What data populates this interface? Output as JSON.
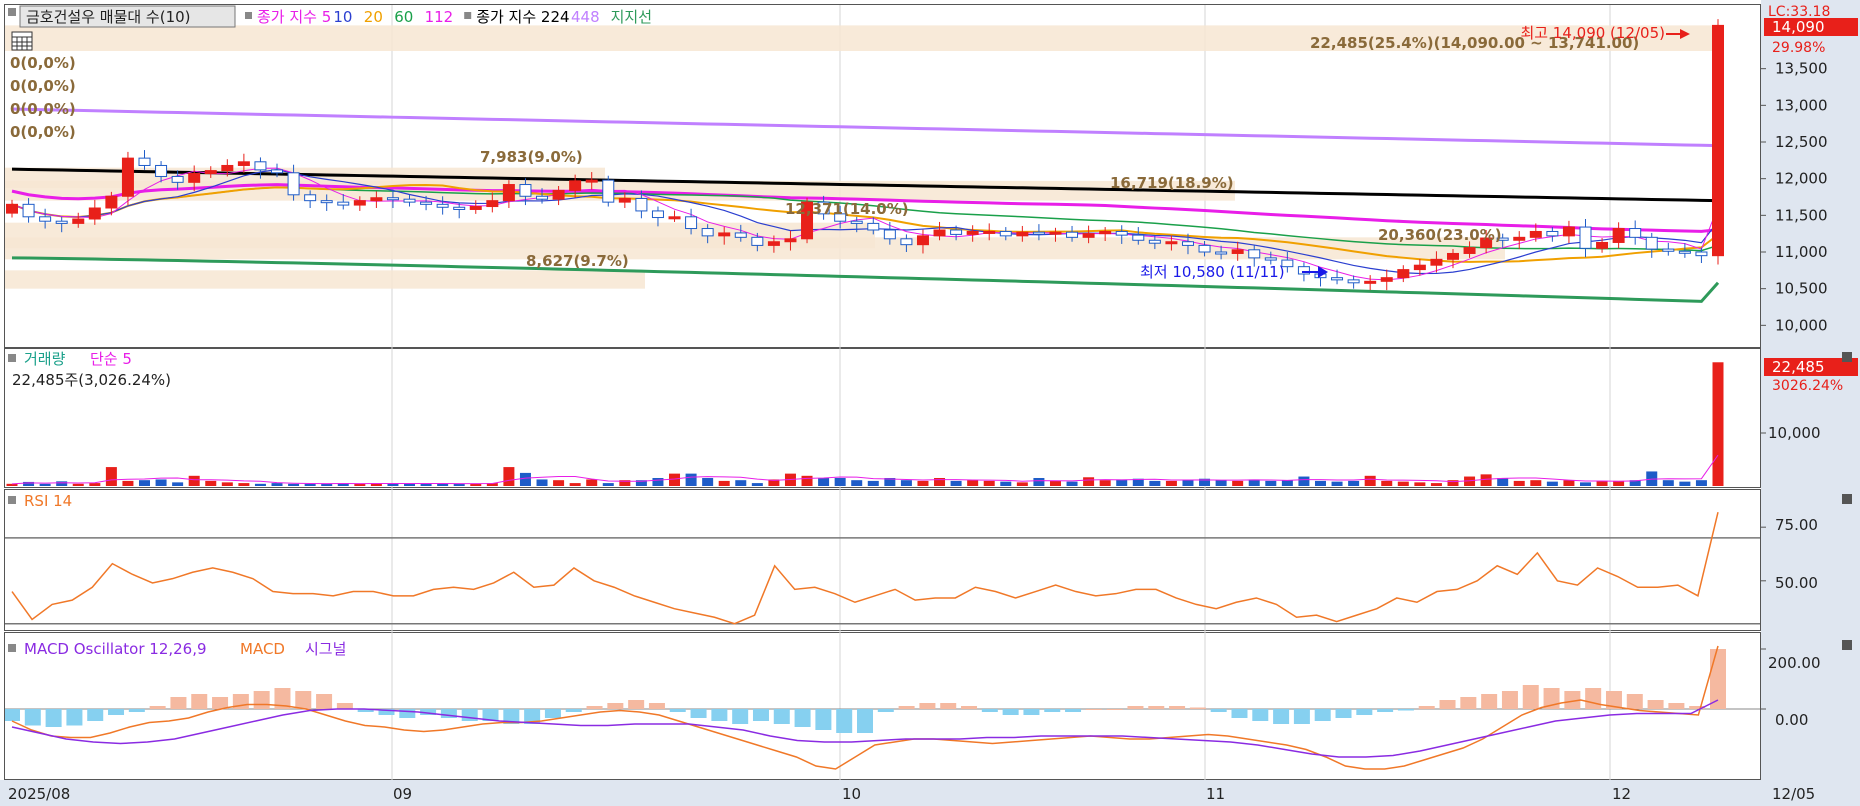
{
  "window": {
    "stock_name_button": "금호건설우 매물대 수(10)",
    "current_date_label": "12/05"
  },
  "main_panel": {
    "legend": [
      {
        "label": "종가 지수 5",
        "color": "#e81ee8"
      },
      {
        "label": "10",
        "color": "#2b3fd0"
      },
      {
        "label": "20",
        "color": "#f0a000"
      },
      {
        "label": "60",
        "color": "#1aa04a"
      },
      {
        "label": "112",
        "color": "#e81ee8"
      },
      {
        "label": "종가 지수 224",
        "color": "#000000"
      },
      {
        "label": "448",
        "color": "#c080ff"
      },
      {
        "label": "지지선",
        "color": "#2e9a5a"
      }
    ],
    "zero_labels": [
      "0(0,0%)",
      "0(0,0%)",
      "0(0,0%)",
      "0(0,0%)"
    ],
    "top_right_label": "LC:33.18",
    "price_badge": "14,090",
    "change_badge": "29.98%",
    "axis_ticks": [
      "13,500",
      "13,000",
      "12,500",
      "12,000",
      "11,500",
      "11,000",
      "10,500",
      "10,000"
    ],
    "annotations": {
      "high": "최고 14,090 (12/05)",
      "low": "최저 10,580 (11/11)",
      "top_band": "22,485(25.4%)(14,090.00 ~ 13,741.00)",
      "band_7983": "7,983(9.0%)",
      "band_16719": "16,719(18.9%)",
      "band_12371": "12,371(14.0%)",
      "band_20360": "20,360(23.0%)",
      "band_8627": "8,627(9.7%)"
    }
  },
  "volume_panel": {
    "title": "거래량",
    "ma_label": "단순 5",
    "value_text": "22,485주(3,026.24%)",
    "badge_value": "22,485",
    "badge_pct": "3026.24%",
    "axis_tick": "10,000"
  },
  "rsi_panel": {
    "title": "RSI 14",
    "axis_ticks": [
      "75.00",
      "50.00"
    ]
  },
  "macd_panel": {
    "osc_label": "MACD Oscillator 12,26,9",
    "macd_label": "MACD",
    "signal_label": "시그널",
    "axis_ticks": [
      "200.00",
      "0.00"
    ]
  },
  "date_axis": {
    "labels": [
      "2025/08",
      "09",
      "10",
      "11",
      "12"
    ]
  },
  "colors": {
    "up": "#e8201a",
    "down": "#1e5cc8",
    "axis_bg": "#dfe6f0",
    "band": "#f7e6d2",
    "rsi": "#f07828",
    "macd": "#f07828",
    "signal": "#8a2be2",
    "osc_pos": "#f5b9a0",
    "osc_neg": "#86d0f0"
  },
  "chart_data": {
    "type": "candlestick",
    "period": "2025/08 – 12/05",
    "closes": [
      11650,
      11480,
      11420,
      11390,
      11450,
      11600,
      11760,
      12280,
      12180,
      12030,
      11950,
      12070,
      12110,
      12180,
      12230,
      12120,
      12080,
      11780,
      11700,
      11680,
      11640,
      11700,
      11740,
      11720,
      11680,
      11650,
      11610,
      11580,
      11620,
      11700,
      11920,
      11760,
      11720,
      11840,
      11970,
      11980,
      11680,
      11730,
      11560,
      11470,
      11480,
      11320,
      11220,
      11260,
      11200,
      11090,
      11140,
      11180,
      11680,
      11520,
      11420,
      11390,
      11300,
      11180,
      11100,
      11220,
      11300,
      11240,
      11280,
      11280,
      11220,
      11270,
      11260,
      11270,
      11200,
      11250,
      11280,
      11230,
      11160,
      11120,
      11140,
      11090,
      11000,
      10980,
      11030,
      10920,
      10890,
      10800,
      10700,
      10650,
      10620,
      10580,
      10600,
      10650,
      10760,
      10820,
      10900,
      10980,
      11060,
      11190,
      11160,
      11200,
      11280,
      11220,
      11340,
      11050,
      11130,
      11320,
      11200,
      11040,
      11010,
      11000,
      10950,
      14090
    ],
    "volume": [
      150,
      280,
      150,
      320,
      150,
      200,
      1300,
      350,
      400,
      450,
      250,
      700,
      350,
      250,
      200,
      150,
      200,
      150,
      150,
      150,
      200,
      150,
      200,
      150,
      150,
      200,
      150,
      150,
      150,
      200,
      1300,
      900,
      450,
      400,
      200,
      450,
      200,
      400,
      400,
      550,
      850,
      850,
      550,
      350,
      400,
      200,
      450,
      850,
      700,
      550,
      550,
      400,
      350,
      550,
      400,
      350,
      550,
      350,
      400,
      350,
      300,
      250,
      550,
      350,
      300,
      600,
      400,
      450,
      500,
      350,
      350,
      400,
      500,
      400,
      350,
      450,
      350,
      400,
      650,
      350,
      300,
      350,
      700,
      350,
      300,
      250,
      200,
      400,
      650,
      800,
      550,
      350,
      400,
      300,
      400,
      250,
      350,
      350,
      400,
      1000,
      400,
      300,
      400,
      8500
    ],
    "ohlc_note": "ohlc derived from closes",
    "rsi": [
      45,
      32,
      39,
      41,
      47,
      58,
      53,
      49,
      51,
      54,
      56,
      54,
      51,
      45,
      44,
      44,
      43,
      45,
      45,
      43,
      43,
      46,
      47,
      46,
      49,
      54,
      47,
      48,
      56,
      50,
      47,
      43,
      40,
      37,
      35,
      33,
      30,
      34,
      57,
      46,
      47,
      44,
      40,
      43,
      46,
      41,
      42,
      42,
      47,
      45,
      42,
      45,
      48,
      45,
      43,
      44,
      46,
      46,
      42,
      39,
      37,
      40,
      42,
      39,
      33,
      34,
      31,
      34,
      37,
      42,
      40,
      45,
      46,
      50,
      57,
      53,
      63,
      50,
      48,
      56,
      52,
      47,
      47,
      48,
      43,
      82
    ],
    "rsi_levels": [
      70,
      30
    ],
    "rsi_ylim": [
      28,
      90
    ],
    "macd": [
      -40,
      -70,
      -90,
      -95,
      -95,
      -80,
      -60,
      -45,
      -40,
      -30,
      -10,
      5,
      15,
      15,
      10,
      0,
      -20,
      -40,
      -55,
      -60,
      -70,
      -75,
      -70,
      -60,
      -50,
      -45,
      -45,
      -40,
      -30,
      -20,
      -10,
      -5,
      -10,
      -20,
      -40,
      -60,
      -80,
      -100,
      -120,
      -140,
      -160,
      -190,
      -200,
      -160,
      -120,
      -110,
      -100,
      -100,
      -105,
      -110,
      -115,
      -110,
      -105,
      -100,
      -95,
      -90,
      -95,
      -100,
      -100,
      -95,
      -90,
      -85,
      -90,
      -100,
      -110,
      -120,
      -135,
      -160,
      -190,
      -200,
      -200,
      -190,
      -170,
      -150,
      -130,
      -100,
      -60,
      -20,
      5,
      20,
      30,
      15,
      5,
      -5,
      -10,
      -15,
      -20,
      210
    ],
    "signal": [
      -60,
      -80,
      -100,
      -110,
      -115,
      -110,
      -100,
      -80,
      -60,
      -40,
      -20,
      -5,
      0,
      0,
      -5,
      -10,
      -20,
      -30,
      -40,
      -45,
      -50,
      -55,
      -55,
      -50,
      -50,
      -50,
      -60,
      -70,
      -90,
      -105,
      -110,
      -110,
      -105,
      -100,
      -100,
      -100,
      -95,
      -95,
      -90,
      -90,
      -90,
      -90,
      -95,
      -100,
      -105,
      -110,
      -120,
      -135,
      -150,
      -160,
      -160,
      -155,
      -140,
      -120,
      -100,
      -80,
      -60,
      -40,
      -30,
      -20,
      -15,
      -15,
      -15,
      30
    ],
    "osc": [
      -40,
      -55,
      -60,
      -55,
      -40,
      -20,
      -10,
      10,
      40,
      50,
      40,
      50,
      60,
      70,
      60,
      50,
      20,
      -10,
      -20,
      -30,
      -20,
      -30,
      -40,
      -40,
      -50,
      -50,
      -30,
      -10,
      10,
      20,
      30,
      20,
      -10,
      -30,
      -40,
      -50,
      -40,
      -50,
      -60,
      -70,
      -80,
      -80,
      -10,
      10,
      20,
      20,
      10,
      -10,
      -20,
      -20,
      -10,
      -10,
      0,
      0,
      10,
      10,
      10,
      5,
      -10,
      -30,
      -40,
      -50,
      -50,
      -40,
      -30,
      -20,
      -10,
      -5,
      10,
      30,
      40,
      50,
      60,
      80,
      70,
      60,
      70,
      60,
      50,
      30,
      20,
      10,
      200
    ],
    "ma_ylim_main": [
      9800,
      14300
    ],
    "volume_ylim": [
      0,
      9000
    ],
    "macd_ylim": [
      -230,
      230
    ]
  }
}
